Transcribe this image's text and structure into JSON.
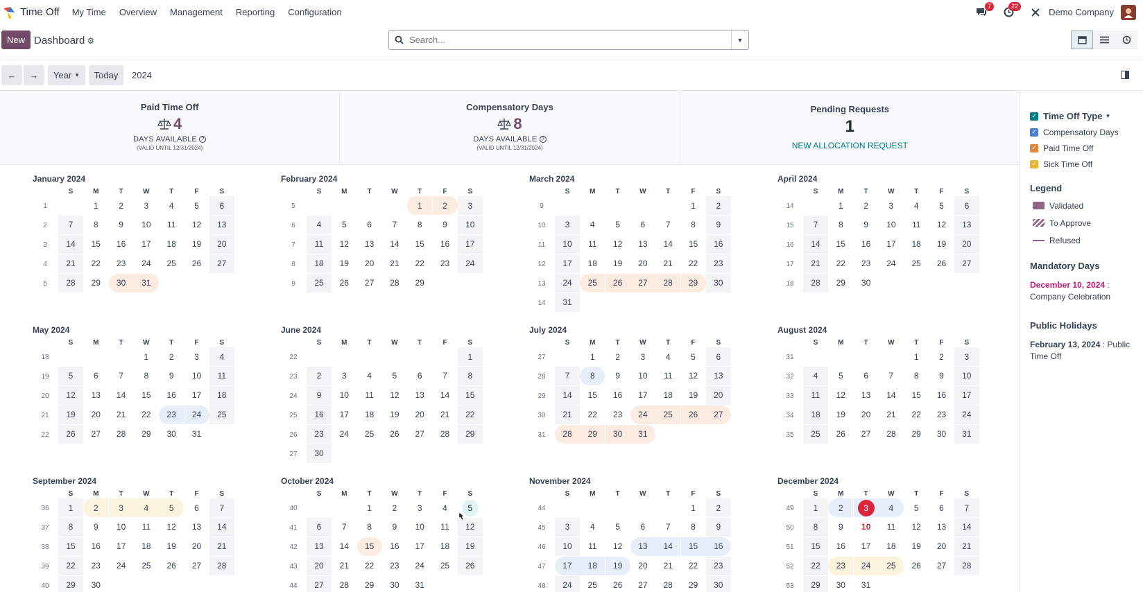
{
  "app": {
    "name": "Time Off"
  },
  "nav": {
    "items": [
      "My Time",
      "Overview",
      "Management",
      "Reporting",
      "Configuration"
    ]
  },
  "topbar": {
    "chat_badge": "7",
    "activity_badge": "22",
    "company": "Demo Company"
  },
  "control": {
    "new_label": "New",
    "title": "Dashboard",
    "search_placeholder": "Search..."
  },
  "nav2": {
    "range_label": "Year",
    "today_label": "Today",
    "year": "2024"
  },
  "summary": {
    "paid": {
      "title": "Paid Time Off",
      "value": "4",
      "days_label": "DAYS AVAILABLE",
      "valid": "(VALID UNTIL 12/31/2024)"
    },
    "comp": {
      "title": "Compensatory Days",
      "value": "8",
      "days_label": "DAYS AVAILABLE",
      "valid": "(VALID UNTIL 12/31/2024)"
    },
    "pending": {
      "title": "Pending Requests",
      "value": "1",
      "link": "NEW ALLOCATION REQUEST"
    }
  },
  "weekdays": [
    "S",
    "M",
    "T",
    "W",
    "T",
    "F",
    "S"
  ],
  "months": [
    {
      "title": "January 2024",
      "start": 1,
      "days": 31,
      "wk": 1
    },
    {
      "title": "February 2024",
      "start": 4,
      "days": 29,
      "wk": 5
    },
    {
      "title": "March 2024",
      "start": 5,
      "days": 31,
      "wk": 9
    },
    {
      "title": "April 2024",
      "start": 1,
      "days": 30,
      "wk": 14
    },
    {
      "title": "May 2024",
      "start": 3,
      "days": 31,
      "wk": 18
    },
    {
      "title": "June 2024",
      "start": 6,
      "days": 30,
      "wk": 22
    },
    {
      "title": "July 2024",
      "start": 1,
      "days": 31,
      "wk": 27
    },
    {
      "title": "August 2024",
      "start": 4,
      "days": 31,
      "wk": 31
    },
    {
      "title": "September 2024",
      "start": 0,
      "days": 30,
      "wk": 36
    },
    {
      "title": "October 2024",
      "start": 2,
      "days": 31,
      "wk": 40
    },
    {
      "title": "November 2024",
      "start": 5,
      "days": 30,
      "wk": 44
    },
    {
      "title": "December 2024",
      "start": 0,
      "days": 31,
      "wk": 49
    }
  ],
  "sidebar": {
    "type_header": "Time Off Type",
    "types": [
      {
        "label": "Compensatory Days",
        "color": "#4a7fd4"
      },
      {
        "label": "Paid Time Off",
        "color": "#e0873a"
      },
      {
        "label": "Sick Time Off",
        "color": "#e8b730"
      }
    ],
    "type_header_color": "#017e84",
    "legend_header": "Legend",
    "legend": [
      {
        "label": "Validated"
      },
      {
        "label": "To Approve"
      },
      {
        "label": "Refused"
      }
    ],
    "mandatory_header": "Mandatory Days",
    "mandatory_date": "December 10, 2024",
    "mandatory_name": "Company Celebration",
    "holidays_header": "Public Holidays",
    "holiday_date": "February 13, 2024",
    "holiday_name": "Public Time Off"
  },
  "colors": {
    "brand": "#714b67",
    "teal": "#017e84",
    "danger": "#d9263a"
  }
}
